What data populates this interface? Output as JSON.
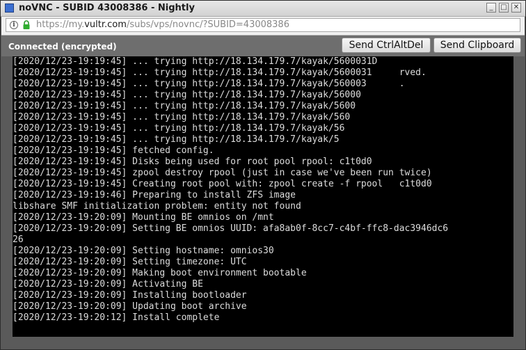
{
  "window": {
    "title": "noVNC - SUBID 43008386 - Nightly",
    "buttons": {
      "minimize": "_",
      "maximize": "□",
      "close": "✕"
    }
  },
  "urlbar": {
    "prefix": "https://my.",
    "domain": "vultr.com",
    "path": "/subs/vps/novnc/?SUBID=43008386"
  },
  "vnc": {
    "status": "Connected (encrypted)",
    "send_ctrlaltdel": "Send CtrlAltDel",
    "send_clipboard": "Send Clipboard"
  },
  "console": {
    "lines": [
      "[2020/12/23-19:19:45] ... trying http://18.134.179.7/kayak/5600031D",
      "[2020/12/23-19:19:45] ... trying http://18.134.179.7/kayak/5600031     rved.",
      "[2020/12/23-19:19:45] ... trying http://18.134.179.7/kayak/560003      .",
      "[2020/12/23-19:19:45] ... trying http://18.134.179.7/kayak/56000",
      "[2020/12/23-19:19:45] ... trying http://18.134.179.7/kayak/5600",
      "[2020/12/23-19:19:45] ... trying http://18.134.179.7/kayak/560",
      "[2020/12/23-19:19:45] ... trying http://18.134.179.7/kayak/56",
      "[2020/12/23-19:19:45] ... trying http://18.134.179.7/kayak/5",
      "[2020/12/23-19:19:45] fetched config.",
      "[2020/12/23-19:19:45] Disks being used for root pool rpool: c1t0d0",
      "[2020/12/23-19:19:45] zpool destroy rpool (just in case we've been run twice)",
      "[2020/12/23-19:19:45] Creating root pool with: zpool create -f rpool   c1t0d0",
      "[2020/12/23-19:19:46] Preparing to install ZFS image",
      "libshare SMF initialization problem: entity not found",
      "[2020/12/23-19:20:09] Mounting BE omnios on /mnt",
      "[2020/12/23-19:20:09] Setting BE omnios UUID: afa8ab0f-8cc7-c4bf-ffc8-dac3946dc6",
      "26",
      "[2020/12/23-19:20:09] Setting hostname: omnios30",
      "[2020/12/23-19:20:09] Setting timezone: UTC",
      "[2020/12/23-19:20:09] Making boot environment bootable",
      "[2020/12/23-19:20:09] Activating BE",
      "[2020/12/23-19:20:09] Installing bootloader",
      "[2020/12/23-19:20:09] Updating boot archive",
      "[2020/12/23-19:20:12] Install complete"
    ]
  }
}
